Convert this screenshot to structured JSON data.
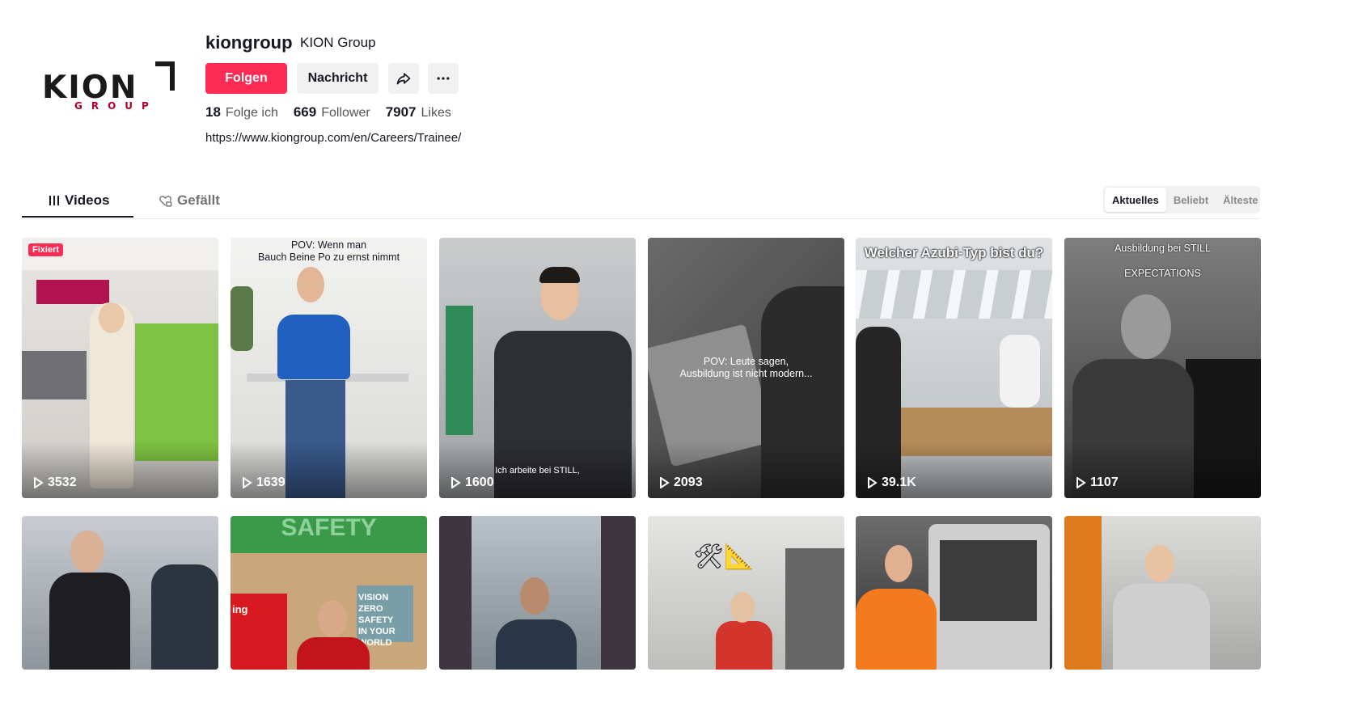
{
  "profile": {
    "logo_text": "KION",
    "logo_subtext": "GROUP",
    "username": "kiongroup",
    "nickname": "KION Group",
    "follow_label": "Folgen",
    "message_label": "Nachricht",
    "share_icon": "share-icon",
    "more_icon": "more-icon",
    "following_count": "18",
    "following_label": "Folge ich",
    "followers_count": "669",
    "followers_label": "Follower",
    "likes_count": "7907",
    "likes_label": "Likes",
    "bio_link": "https://www.kiongroup.com/en/Careers/Trainee/"
  },
  "tabs": {
    "videos": "Videos",
    "liked": "Gefällt"
  },
  "sort": {
    "options": [
      "Aktuelles",
      "Beliebt",
      "Älteste"
    ],
    "active": "Aktuelles"
  },
  "colors": {
    "accent": "#fe2c55",
    "brand_red": "#b3002d"
  },
  "videos": [
    {
      "views": "3532",
      "pinned": "Fixiert"
    },
    {
      "views": "1639",
      "caption": "POV: Wenn man\nBauch Beine Po zu ernst nimmt"
    },
    {
      "views": "1600",
      "caption": "Ich arbeite bei STILL,"
    },
    {
      "views": "2093",
      "caption": "POV: Leute sagen,\nAusbildung ist nicht modern..."
    },
    {
      "views": "39.1K",
      "caption": "Welcher Azubi-Typ bist du?"
    },
    {
      "views": "1107",
      "caption": "Ausbildung bei STILL",
      "caption2": "EXPECTATIONS"
    },
    {
      "views": ""
    },
    {
      "views": "",
      "caption": "VISION ZERO\nSAFETY\nIN YOUR\nWORLD",
      "caption2": "SAFETY",
      "caption3": "ing"
    },
    {
      "views": ""
    },
    {
      "views": ""
    },
    {
      "views": ""
    },
    {
      "views": ""
    }
  ]
}
